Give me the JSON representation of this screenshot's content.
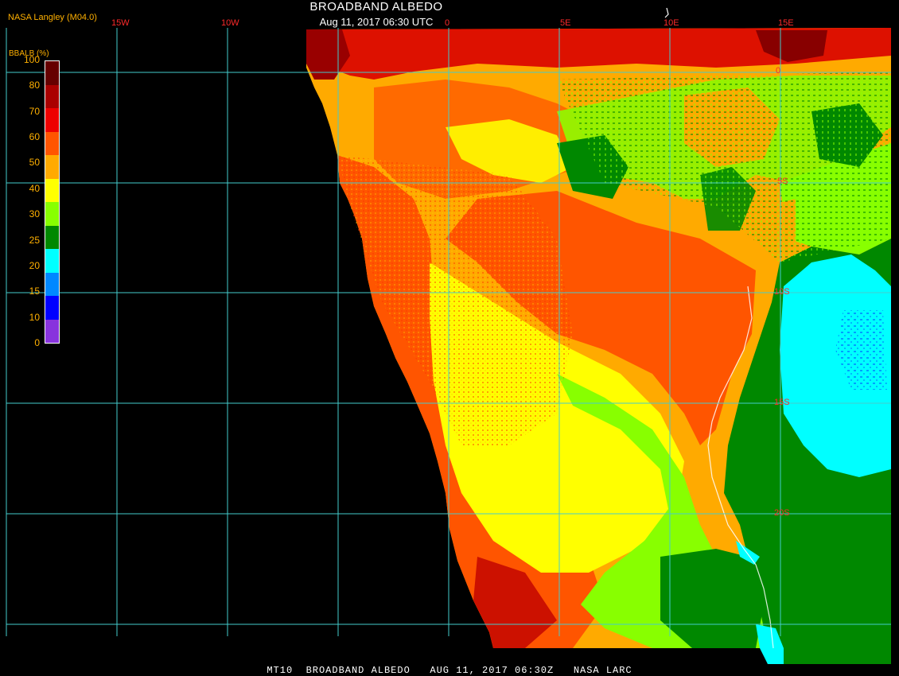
{
  "header": {
    "title": "BROADBAND ALBEDO",
    "subtitle": "Aug 11, 2017 06:30 UTC",
    "organization": "NASA Langley (M04.0)"
  },
  "footer": {
    "text": "MT10  BROADBAND ALBEDO   AUG 11, 2017 06:30Z   NASA LARC"
  },
  "legend": {
    "title": "BBALB (%)",
    "ticks": [
      "100",
      "80",
      "70",
      "60",
      "50",
      "40",
      "30",
      "25",
      "20",
      "15",
      "10",
      "0"
    ],
    "colors": [
      "#660000",
      "#aa0000",
      "#ee0000",
      "#ff5500",
      "#ffaa00",
      "#ffff00",
      "#88ff00",
      "#008800",
      "#00ffff",
      "#0088ff",
      "#0000ff",
      "#8833dd"
    ]
  },
  "grid": {
    "longitude_labels": [
      "15W",
      "10W",
      "0",
      "5E",
      "10E",
      "15E"
    ],
    "latitude_labels": [
      "0",
      "5S",
      "10S",
      "15S",
      "20S"
    ],
    "line_color": "#44cccc"
  },
  "map": {
    "region": "Southwestern Africa and South Atlantic",
    "colors": {
      "very_high": "#880000",
      "high": "#ee1100",
      "orange_red": "#ff5500",
      "orange": "#ffaa00",
      "yellow": "#ffff00",
      "light_green": "#88ff00",
      "green": "#008800",
      "cyan": "#00ffff",
      "blue": "#0088ff",
      "no_data": "#000000"
    }
  }
}
